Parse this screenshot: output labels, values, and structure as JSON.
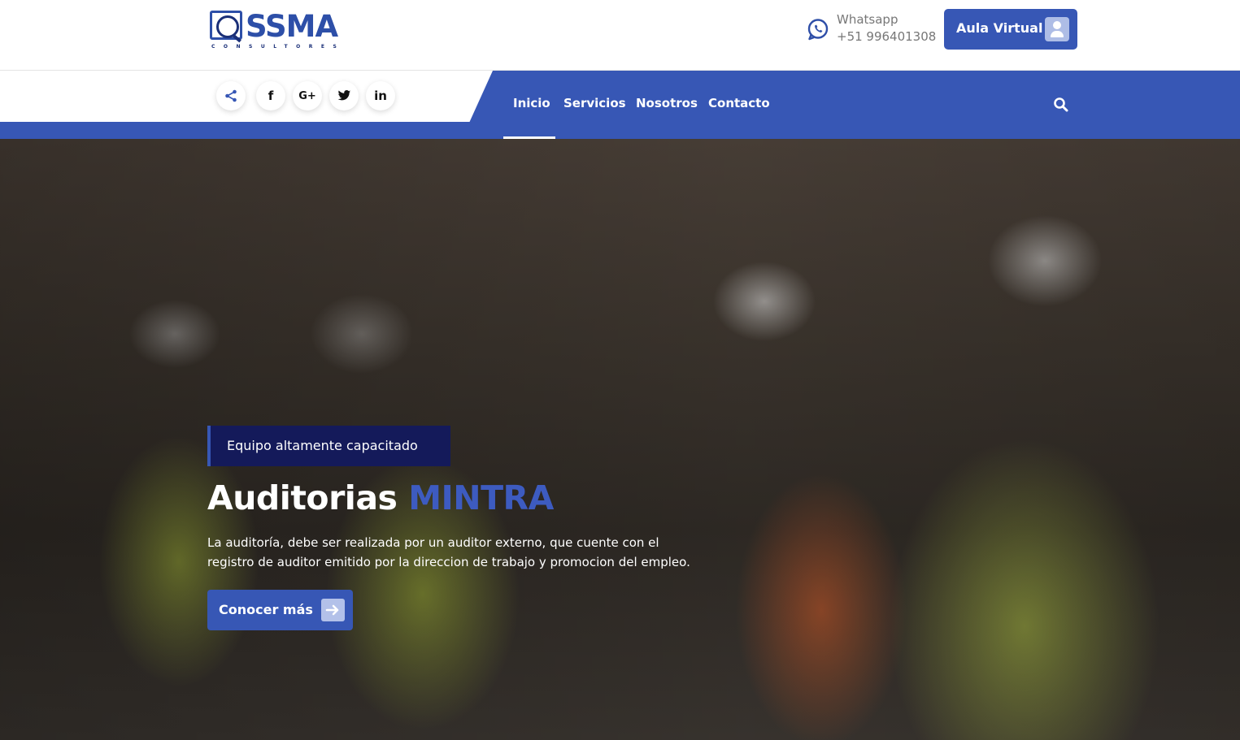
{
  "header": {
    "logo": {
      "brand": "SSMA",
      "tagline": "CONSULTORES",
      "icon": "magnifier-logo-icon"
    },
    "whatsapp": {
      "label": "Whatsapp",
      "phone": "+51 996401308",
      "icon": "whatsapp-icon"
    },
    "aula_virtual": {
      "label": "Aula Virtual",
      "icon": "user-icon"
    }
  },
  "social": [
    {
      "name": "share",
      "icon": "share-icon"
    },
    {
      "name": "facebook",
      "icon": "facebook-icon",
      "glyph": "f"
    },
    {
      "name": "google-plus",
      "icon": "google-plus-icon",
      "glyph": "G+"
    },
    {
      "name": "twitter",
      "icon": "twitter-icon"
    },
    {
      "name": "linkedin",
      "icon": "linkedin-icon",
      "glyph": "in"
    }
  ],
  "nav": {
    "items": [
      {
        "label": "Inicio",
        "active": true
      },
      {
        "label": "Servicios",
        "active": false
      },
      {
        "label": "Nosotros",
        "active": false
      },
      {
        "label": "Contacto",
        "active": false
      }
    ],
    "search_icon": "search-icon"
  },
  "hero": {
    "tag": "Equipo altamente capacitado",
    "title_main": "Auditorias",
    "title_accent": "MINTRA",
    "description_lines": [
      "La auditoría, debe ser realizada por un auditor externo, que cuente con el",
      "registro de auditor emitido por la direccion de trabajo y promocion del empleo."
    ],
    "cta_label": "Conocer más",
    "cta_icon": "arrow-right-icon"
  },
  "colors": {
    "primary": "#3757b5",
    "tag_bg": "#141a5a",
    "accent_text": "#3d5bc0",
    "white": "#ffffff"
  }
}
